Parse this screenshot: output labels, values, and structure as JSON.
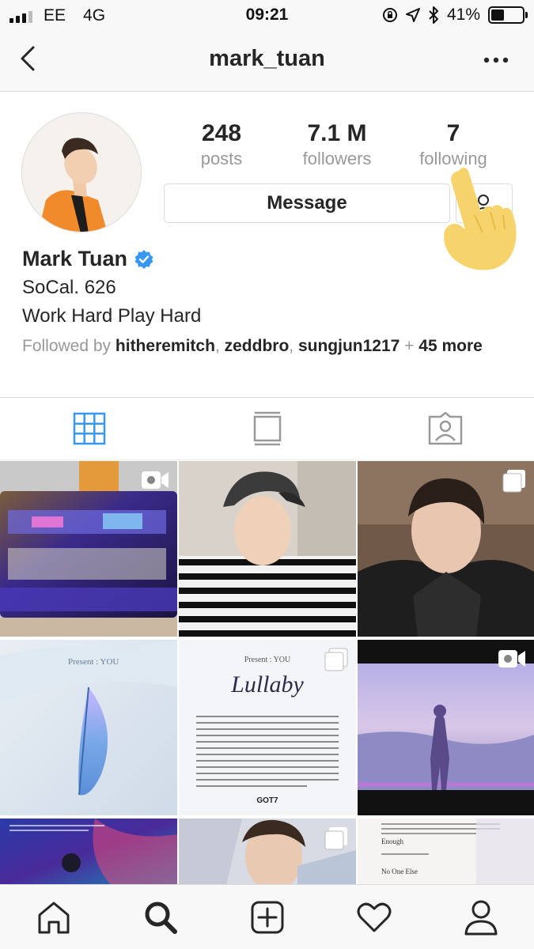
{
  "status_bar": {
    "carrier": "EE",
    "network": "4G",
    "time": "09:21",
    "battery": "41%",
    "battery_level": 0.41
  },
  "nav": {
    "title": "mark_tuan",
    "back_icon": "chevron-left-icon",
    "more_icon": "more-icon"
  },
  "profile": {
    "stats": [
      {
        "value": "248",
        "label": "posts"
      },
      {
        "value": "7.1 M",
        "label": "followers"
      },
      {
        "value": "7",
        "label": "following"
      }
    ],
    "message_label": "Message",
    "name": "Mark Tuan",
    "bio": [
      "SoCal. 626",
      "Work Hard Play Hard"
    ],
    "followed_by": {
      "prefix": "Followed by",
      "users": [
        "hitheremitch",
        "zeddbro",
        "sungjun1217"
      ],
      "suffix_plus": "+",
      "suffix_count": "45",
      "suffix_more": "more"
    }
  },
  "tabs": [
    {
      "icon": "grid-icon",
      "active": true
    },
    {
      "icon": "feed-icon",
      "active": false
    },
    {
      "icon": "tagged-icon",
      "active": false
    }
  ],
  "posts": [
    {
      "type": "video",
      "desc": "concert stage"
    },
    {
      "type": "photo",
      "desc": "striped shirt cap selfie"
    },
    {
      "type": "carousel",
      "desc": "black jacket selfie"
    },
    {
      "type": "photo",
      "desc": "blue feather",
      "text": "Present : YOU"
    },
    {
      "type": "carousel",
      "desc": "lullaby lyrics",
      "text": "Present : YOU",
      "title": "Lullaby",
      "footer": "GOT7"
    },
    {
      "type": "video",
      "desc": "walking silhouette"
    },
    {
      "type": "photo",
      "desc": "purple abstract"
    },
    {
      "type": "carousel",
      "desc": "portrait"
    },
    {
      "type": "photo",
      "desc": "tracklist",
      "tracks": [
        "Enough",
        "No One Else"
      ]
    }
  ],
  "tab_bar": [
    "home-icon",
    "search-icon",
    "add-icon",
    "heart-icon",
    "profile-icon"
  ],
  "colors": {
    "accent": "#3897f0",
    "verified": "#3897f0",
    "text": "#262626",
    "muted": "#999999",
    "hand": "#f6d36b"
  }
}
